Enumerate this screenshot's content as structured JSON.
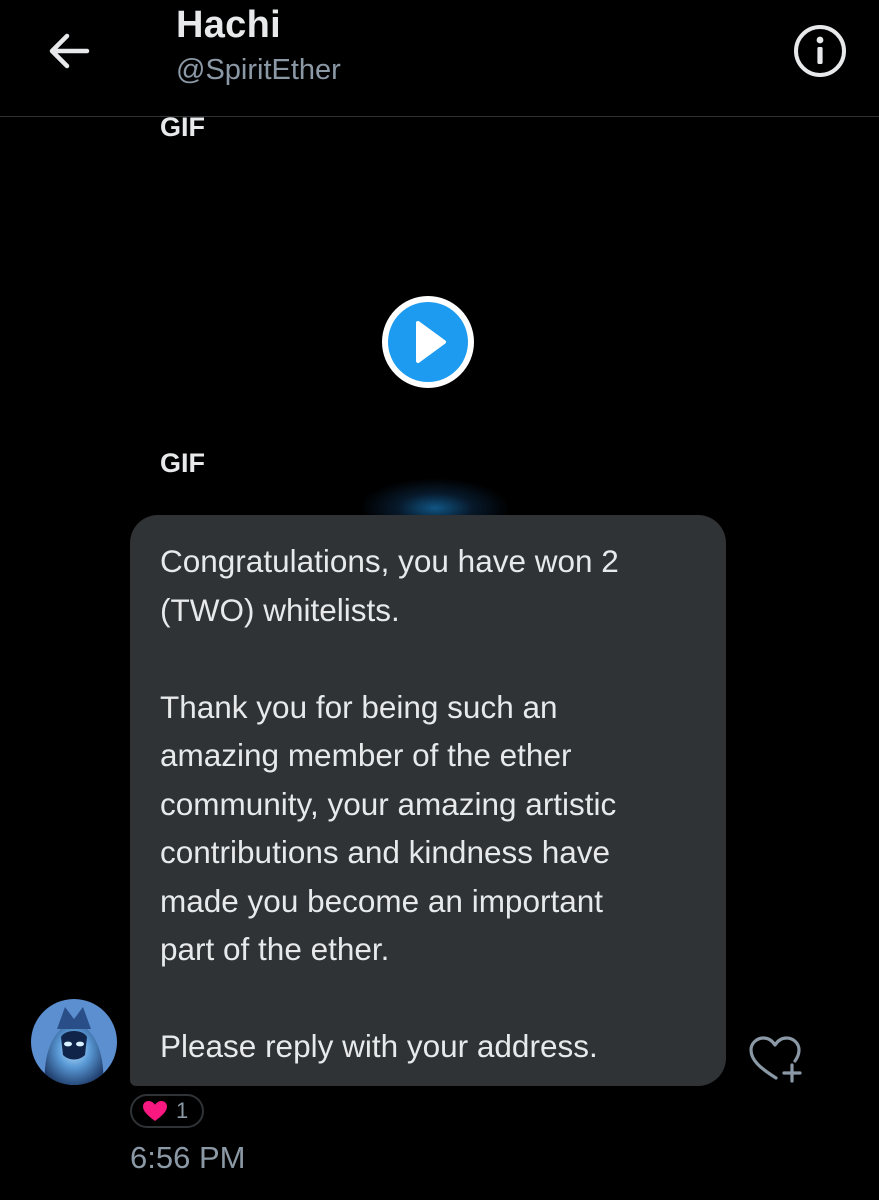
{
  "header": {
    "name": "Hachi",
    "handle": "@SpiritEther"
  },
  "gifs": [
    {
      "label": "GIF"
    },
    {
      "label": "GIF"
    }
  ],
  "message": {
    "text": "Congratulations, you have won 2\n(TWO) whitelists.\n\nThank you for being such an\namazing member of the ether\ncommunity, your amazing artistic\ncontributions and kindness have\nmade you become an important\npart of the ether.\n\nPlease reply with your address.",
    "reaction_count": "1",
    "timestamp": "6:56 PM"
  },
  "icons": {
    "back": "arrow-left-icon",
    "info": "info-icon",
    "play": "play-icon",
    "reaction": "heart-icon",
    "add_reaction": "heart-plus-icon"
  },
  "colors": {
    "background": "#000000",
    "bubble": "#2f3336",
    "accent": "#1d9bf0",
    "heart": "#f91880",
    "secondary_text": "#8b98a5",
    "primary_text": "#e7e9ea"
  }
}
